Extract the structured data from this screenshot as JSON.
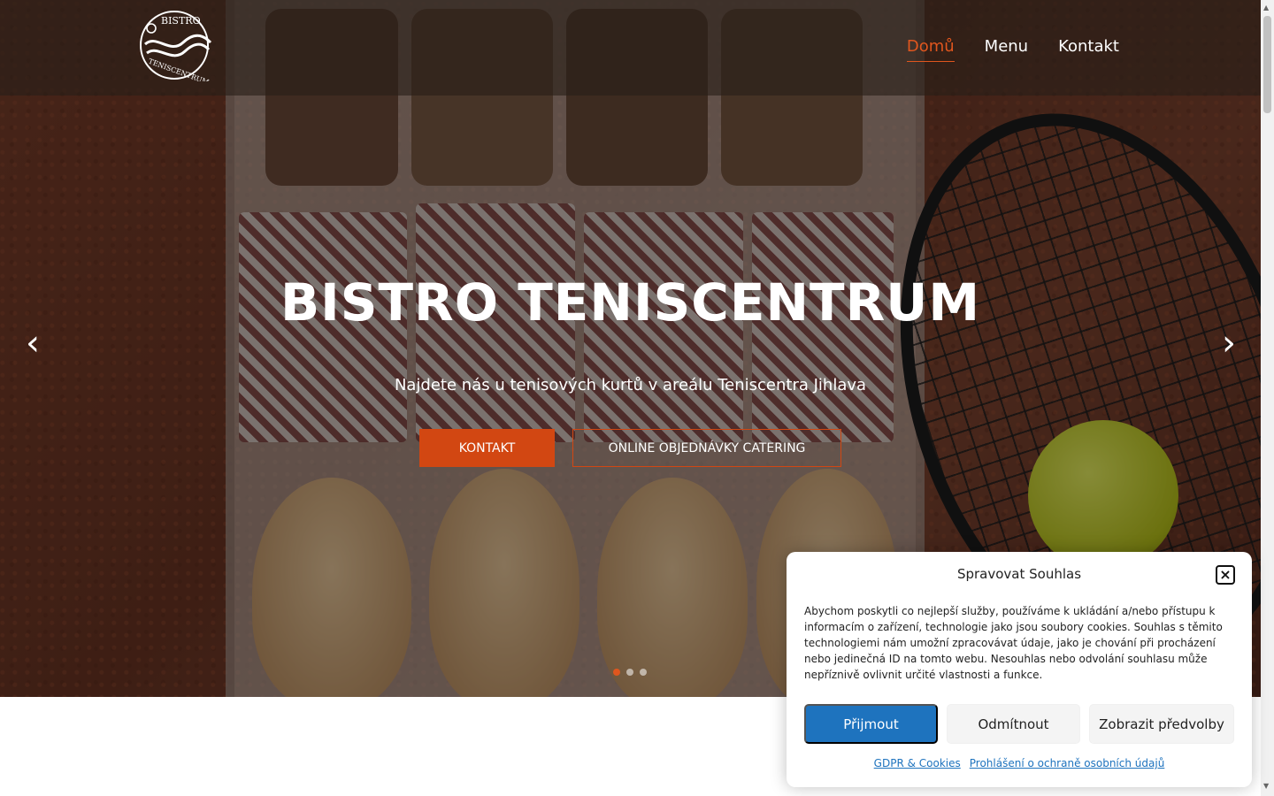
{
  "header": {
    "logo_alt": "Bistro Teniscentrum",
    "nav": [
      {
        "label": "Domů"
      },
      {
        "label": "Menu"
      },
      {
        "label": "Kontakt"
      }
    ]
  },
  "hero": {
    "title": "BISTRO TENISCENTRUM",
    "subtitle": "Najdete nás u tenisových kurtů v areálu Teniscentra Jihlava",
    "primary_button": "KONTAKT",
    "secondary_button": "ONLINE OBJEDNÁVKY CATERING",
    "prev_arrow": "‹",
    "next_arrow": "›",
    "slides_count": 3,
    "active_slide": 1
  },
  "consent": {
    "title": "Spravovat Souhlas",
    "close_glyph": "×",
    "text": "Abychom poskytli co nejlepší služby, používáme k ukládání a/nebo přístupu k informacím o zařízení, technologie jako jsou soubory cookies. Souhlas s těmito technologiemi nám umožní zpracovávat údaje, jako je chování při procházení nebo jedinečná ID na tomto webu. Nesouhlas nebo odvolání souhlasu může nepříznivě ovlivnit určité vlastnosti a funkce.",
    "accept_label": "Přijmout",
    "deny_label": "Odmítnout",
    "prefs_label": "Zobrazit předvolby",
    "links": [
      "GDPR & Cookies",
      "Prohlášení o ochraně osobních údajů"
    ]
  },
  "colors": {
    "accent": "#d24712",
    "nav_active": "#e0561e",
    "consent_primary": "#1e73be"
  }
}
